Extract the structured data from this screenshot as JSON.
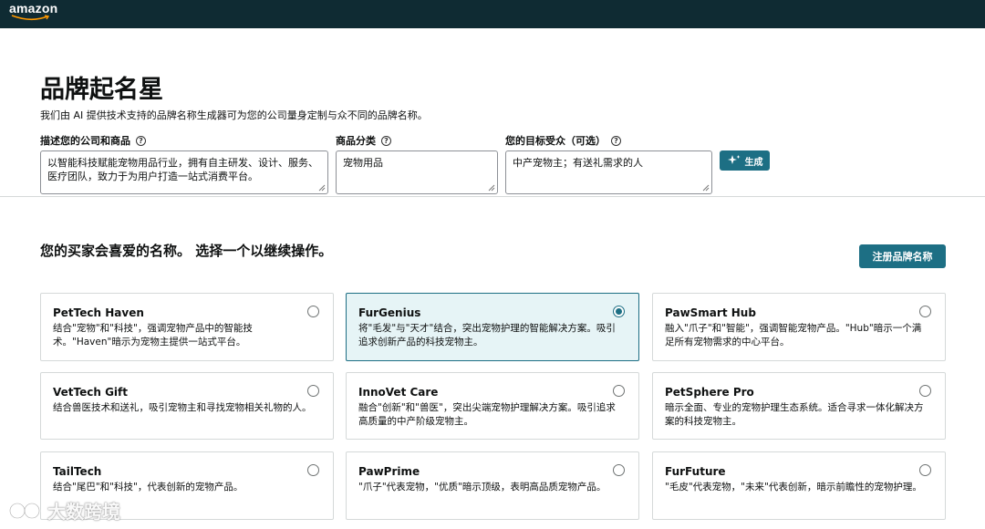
{
  "header": {
    "logo_text": "amazon",
    "background": "#0f2b33"
  },
  "page": {
    "title": "品牌起名星",
    "description": "我们由 AI 提供技术支持的品牌名称生成器可为您的公司量身定制与众不同的品牌名称。"
  },
  "form": {
    "company_label": "描述您的公司和商品",
    "company_value": "以智能科技赋能宠物用品行业，拥有自主研发、设计、服务、医疗团队，致力于为用户打造一站式消费平台。",
    "category_label": "商品分类",
    "category_value": "宠物用品",
    "audience_label": "您的目标受众（可选）",
    "audience_value": "中产宠物主；有送礼需求的人",
    "generate_label": "生成",
    "help_icon": "?"
  },
  "results": {
    "title": "您的买家会喜爱的名称。 选择一个以继续操作。",
    "register_label": "注册品牌名称",
    "cards": [
      {
        "name": "PetTech Haven",
        "desc": "结合\"宠物\"和\"科技\"，强调宠物产品中的智能技术。\"Haven\"暗示为宠物主提供一站式平台。",
        "selected": false
      },
      {
        "name": "FurGenius",
        "desc": "将\"毛发\"与\"天才\"结合，突出宠物护理的智能解决方案。吸引追求创新产品的科技宠物主。",
        "selected": true
      },
      {
        "name": "PawSmart Hub",
        "desc": "融入\"爪子\"和\"智能\"，强调智能宠物产品。\"Hub\"暗示一个满足所有宠物需求的中心平台。",
        "selected": false
      },
      {
        "name": "VetTech Gift",
        "desc": "结合兽医技术和送礼，吸引宠物主和寻找宠物相关礼物的人。",
        "selected": false
      },
      {
        "name": "InnoVet Care",
        "desc": "融合\"创新\"和\"兽医\"，突出尖端宠物护理解决方案。吸引追求高质量的中产阶级宠物主。",
        "selected": false
      },
      {
        "name": "PetSphere Pro",
        "desc": "暗示全面、专业的宠物护理生态系统。适合寻求一体化解决方案的科技宠物主。",
        "selected": false
      },
      {
        "name": "TailTech",
        "desc": "结合\"尾巴\"和\"科技\"，代表创新的宠物产品。",
        "selected": false
      },
      {
        "name": "PawPrime",
        "desc": "\"爪子\"代表宠物，\"优质\"暗示顶级，表明高品质宠物产品。",
        "selected": false
      },
      {
        "name": "FurFuture",
        "desc": "\"毛皮\"代表宠物，\"未来\"代表创新，暗示前瞻性的宠物护理。",
        "selected": false
      }
    ]
  },
  "watermark": {
    "text": "大数跨境"
  },
  "colors": {
    "accent": "#1d6f84",
    "selected_bg": "#e6f4f6"
  }
}
